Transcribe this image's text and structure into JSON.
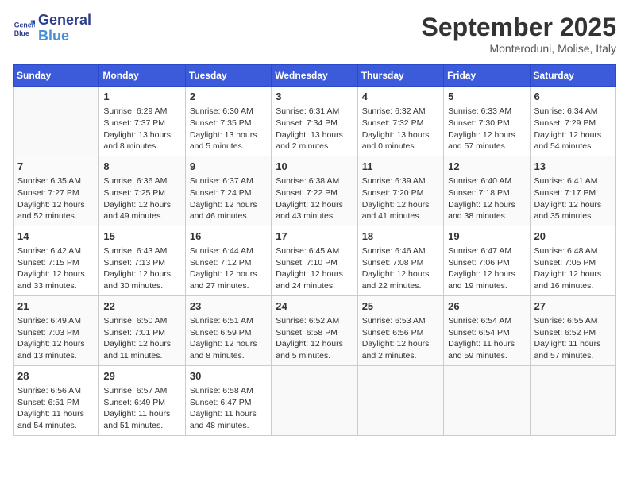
{
  "header": {
    "logo_line1": "General",
    "logo_line2": "Blue",
    "month": "September 2025",
    "location": "Monteroduni, Molise, Italy"
  },
  "weekdays": [
    "Sunday",
    "Monday",
    "Tuesday",
    "Wednesday",
    "Thursday",
    "Friday",
    "Saturday"
  ],
  "weeks": [
    [
      {
        "day": "",
        "info": ""
      },
      {
        "day": "1",
        "info": "Sunrise: 6:29 AM\nSunset: 7:37 PM\nDaylight: 13 hours\nand 8 minutes."
      },
      {
        "day": "2",
        "info": "Sunrise: 6:30 AM\nSunset: 7:35 PM\nDaylight: 13 hours\nand 5 minutes."
      },
      {
        "day": "3",
        "info": "Sunrise: 6:31 AM\nSunset: 7:34 PM\nDaylight: 13 hours\nand 2 minutes."
      },
      {
        "day": "4",
        "info": "Sunrise: 6:32 AM\nSunset: 7:32 PM\nDaylight: 13 hours\nand 0 minutes."
      },
      {
        "day": "5",
        "info": "Sunrise: 6:33 AM\nSunset: 7:30 PM\nDaylight: 12 hours\nand 57 minutes."
      },
      {
        "day": "6",
        "info": "Sunrise: 6:34 AM\nSunset: 7:29 PM\nDaylight: 12 hours\nand 54 minutes."
      }
    ],
    [
      {
        "day": "7",
        "info": "Sunrise: 6:35 AM\nSunset: 7:27 PM\nDaylight: 12 hours\nand 52 minutes."
      },
      {
        "day": "8",
        "info": "Sunrise: 6:36 AM\nSunset: 7:25 PM\nDaylight: 12 hours\nand 49 minutes."
      },
      {
        "day": "9",
        "info": "Sunrise: 6:37 AM\nSunset: 7:24 PM\nDaylight: 12 hours\nand 46 minutes."
      },
      {
        "day": "10",
        "info": "Sunrise: 6:38 AM\nSunset: 7:22 PM\nDaylight: 12 hours\nand 43 minutes."
      },
      {
        "day": "11",
        "info": "Sunrise: 6:39 AM\nSunset: 7:20 PM\nDaylight: 12 hours\nand 41 minutes."
      },
      {
        "day": "12",
        "info": "Sunrise: 6:40 AM\nSunset: 7:18 PM\nDaylight: 12 hours\nand 38 minutes."
      },
      {
        "day": "13",
        "info": "Sunrise: 6:41 AM\nSunset: 7:17 PM\nDaylight: 12 hours\nand 35 minutes."
      }
    ],
    [
      {
        "day": "14",
        "info": "Sunrise: 6:42 AM\nSunset: 7:15 PM\nDaylight: 12 hours\nand 33 minutes."
      },
      {
        "day": "15",
        "info": "Sunrise: 6:43 AM\nSunset: 7:13 PM\nDaylight: 12 hours\nand 30 minutes."
      },
      {
        "day": "16",
        "info": "Sunrise: 6:44 AM\nSunset: 7:12 PM\nDaylight: 12 hours\nand 27 minutes."
      },
      {
        "day": "17",
        "info": "Sunrise: 6:45 AM\nSunset: 7:10 PM\nDaylight: 12 hours\nand 24 minutes."
      },
      {
        "day": "18",
        "info": "Sunrise: 6:46 AM\nSunset: 7:08 PM\nDaylight: 12 hours\nand 22 minutes."
      },
      {
        "day": "19",
        "info": "Sunrise: 6:47 AM\nSunset: 7:06 PM\nDaylight: 12 hours\nand 19 minutes."
      },
      {
        "day": "20",
        "info": "Sunrise: 6:48 AM\nSunset: 7:05 PM\nDaylight: 12 hours\nand 16 minutes."
      }
    ],
    [
      {
        "day": "21",
        "info": "Sunrise: 6:49 AM\nSunset: 7:03 PM\nDaylight: 12 hours\nand 13 minutes."
      },
      {
        "day": "22",
        "info": "Sunrise: 6:50 AM\nSunset: 7:01 PM\nDaylight: 12 hours\nand 11 minutes."
      },
      {
        "day": "23",
        "info": "Sunrise: 6:51 AM\nSunset: 6:59 PM\nDaylight: 12 hours\nand 8 minutes."
      },
      {
        "day": "24",
        "info": "Sunrise: 6:52 AM\nSunset: 6:58 PM\nDaylight: 12 hours\nand 5 minutes."
      },
      {
        "day": "25",
        "info": "Sunrise: 6:53 AM\nSunset: 6:56 PM\nDaylight: 12 hours\nand 2 minutes."
      },
      {
        "day": "26",
        "info": "Sunrise: 6:54 AM\nSunset: 6:54 PM\nDaylight: 11 hours\nand 59 minutes."
      },
      {
        "day": "27",
        "info": "Sunrise: 6:55 AM\nSunset: 6:52 PM\nDaylight: 11 hours\nand 57 minutes."
      }
    ],
    [
      {
        "day": "28",
        "info": "Sunrise: 6:56 AM\nSunset: 6:51 PM\nDaylight: 11 hours\nand 54 minutes."
      },
      {
        "day": "29",
        "info": "Sunrise: 6:57 AM\nSunset: 6:49 PM\nDaylight: 11 hours\nand 51 minutes."
      },
      {
        "day": "30",
        "info": "Sunrise: 6:58 AM\nSunset: 6:47 PM\nDaylight: 11 hours\nand 48 minutes."
      },
      {
        "day": "",
        "info": ""
      },
      {
        "day": "",
        "info": ""
      },
      {
        "day": "",
        "info": ""
      },
      {
        "day": "",
        "info": ""
      }
    ]
  ]
}
